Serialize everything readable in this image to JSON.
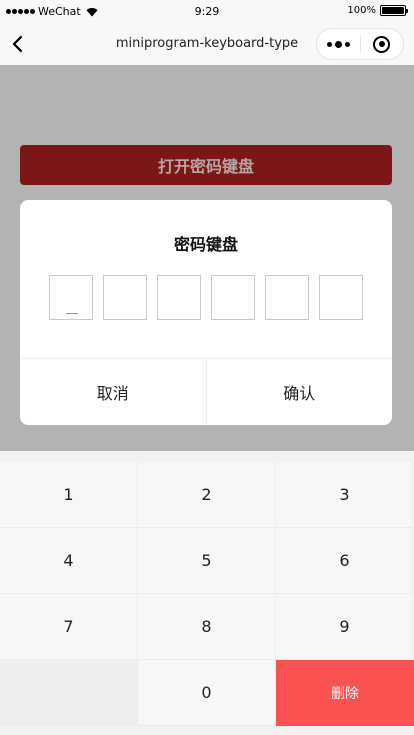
{
  "status_bar": {
    "carrier": "WeChat",
    "time": "9:29",
    "battery": "100%"
  },
  "nav": {
    "title": "miniprogram-keyboard-type"
  },
  "page": {
    "open_button_label": "打开密码键盘"
  },
  "dialog": {
    "title": "密码键盘",
    "password_boxes": [
      "",
      "",
      "",
      "",
      "",
      ""
    ],
    "cancel_label": "取消",
    "confirm_label": "确认"
  },
  "keypad": {
    "keys": [
      "1",
      "2",
      "3",
      "4",
      "5",
      "6",
      "7",
      "8",
      "9",
      "",
      "0",
      "删除"
    ]
  },
  "colors": {
    "open_button_bg": "#7b1717",
    "overlay": "#b3b3b3",
    "delete_key_bg": "#fa5151",
    "cursor": "#3aa0ff"
  }
}
